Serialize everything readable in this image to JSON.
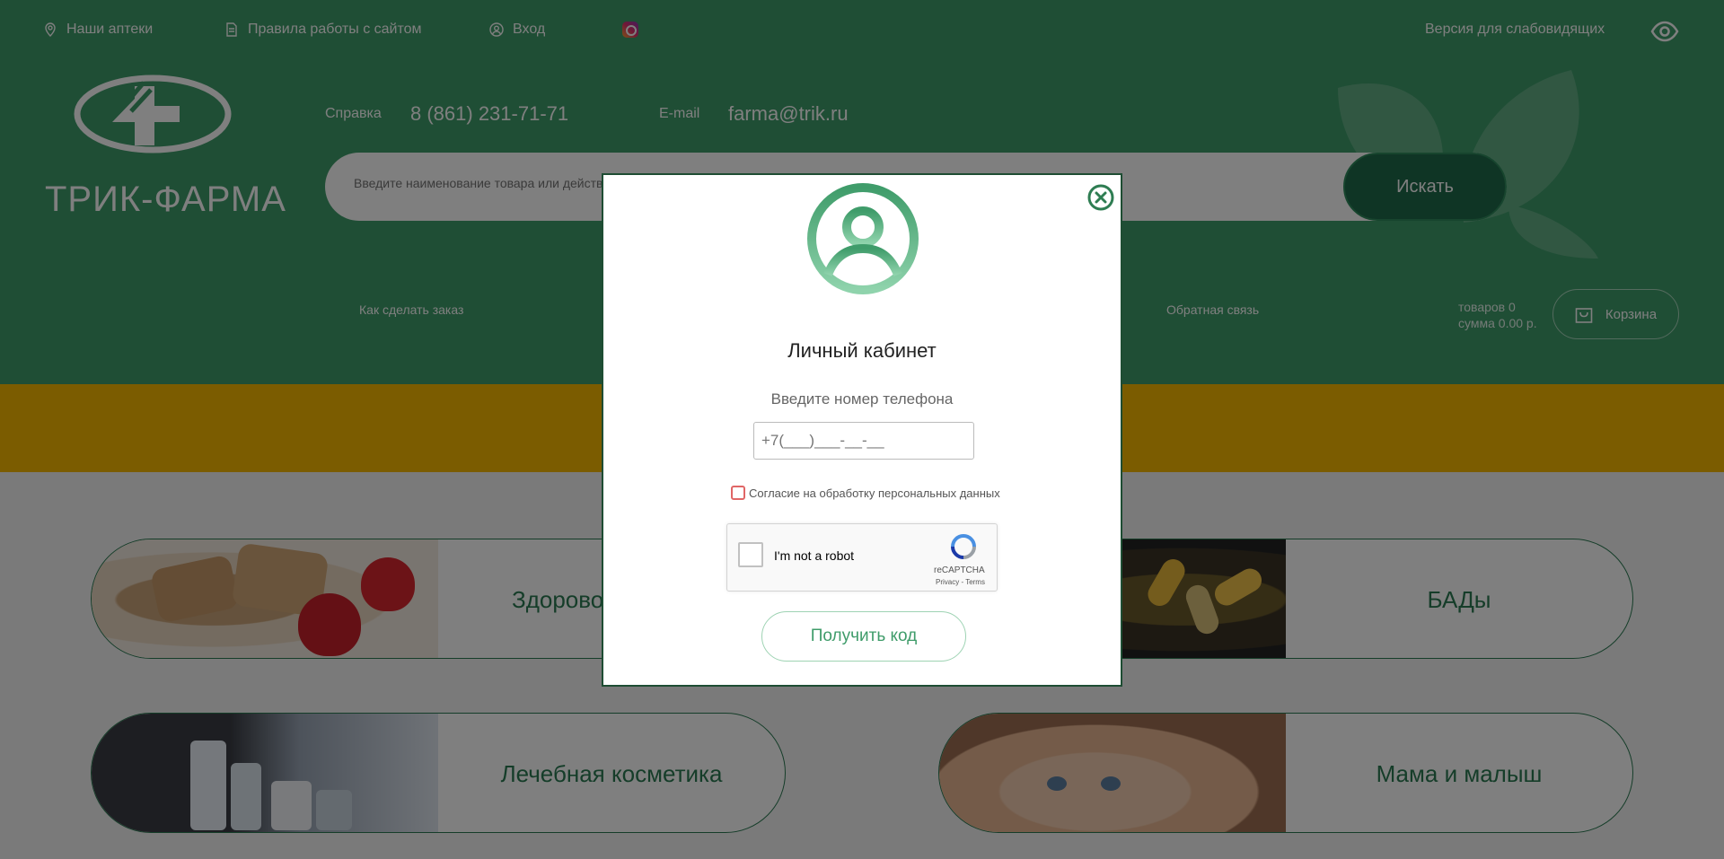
{
  "topbar": {
    "pharmacies": "Наши аптеки",
    "rules": "Правила работы с сайтом",
    "login": "Вход",
    "low_vision": "Версия для слабовидящих"
  },
  "header": {
    "brand": "ТРИК-ФАРМА",
    "help_label": "Справка",
    "phone": "8 (861) 231-71-71",
    "email_label": "E-mail",
    "email": "farma@trik.ru"
  },
  "search": {
    "placeholder": "Введите наименование товара или действующего вещества",
    "button": "Искать"
  },
  "nav": {
    "how_to_order": "Как сделать заказ",
    "feedback": "Обратная связь"
  },
  "cart": {
    "items_label": "товаров",
    "items_count": "0",
    "sum_label": "сумма",
    "sum_value": "0.00 р.",
    "button": "Корзина"
  },
  "categories": [
    {
      "label": "Здоровое питание"
    },
    {
      "label": "БАДы"
    },
    {
      "label": "Лечебная косметика"
    },
    {
      "label": "Мама и малыш"
    }
  ],
  "modal": {
    "title": "Личный кабинет",
    "subtitle": "Введите номер телефона",
    "phone_placeholder": "+7(___)___-__-__",
    "consent": "Согласие на обработку персональных данных",
    "recaptcha_text": "I'm not a robot",
    "recaptcha_brand": "reCAPTCHA",
    "recaptcha_terms": "Privacy - Terms",
    "submit": "Получить код"
  },
  "colors": {
    "header_green": "#3f9c6a",
    "dark_green": "#1f6a4a",
    "yellow": "#f6b800"
  }
}
